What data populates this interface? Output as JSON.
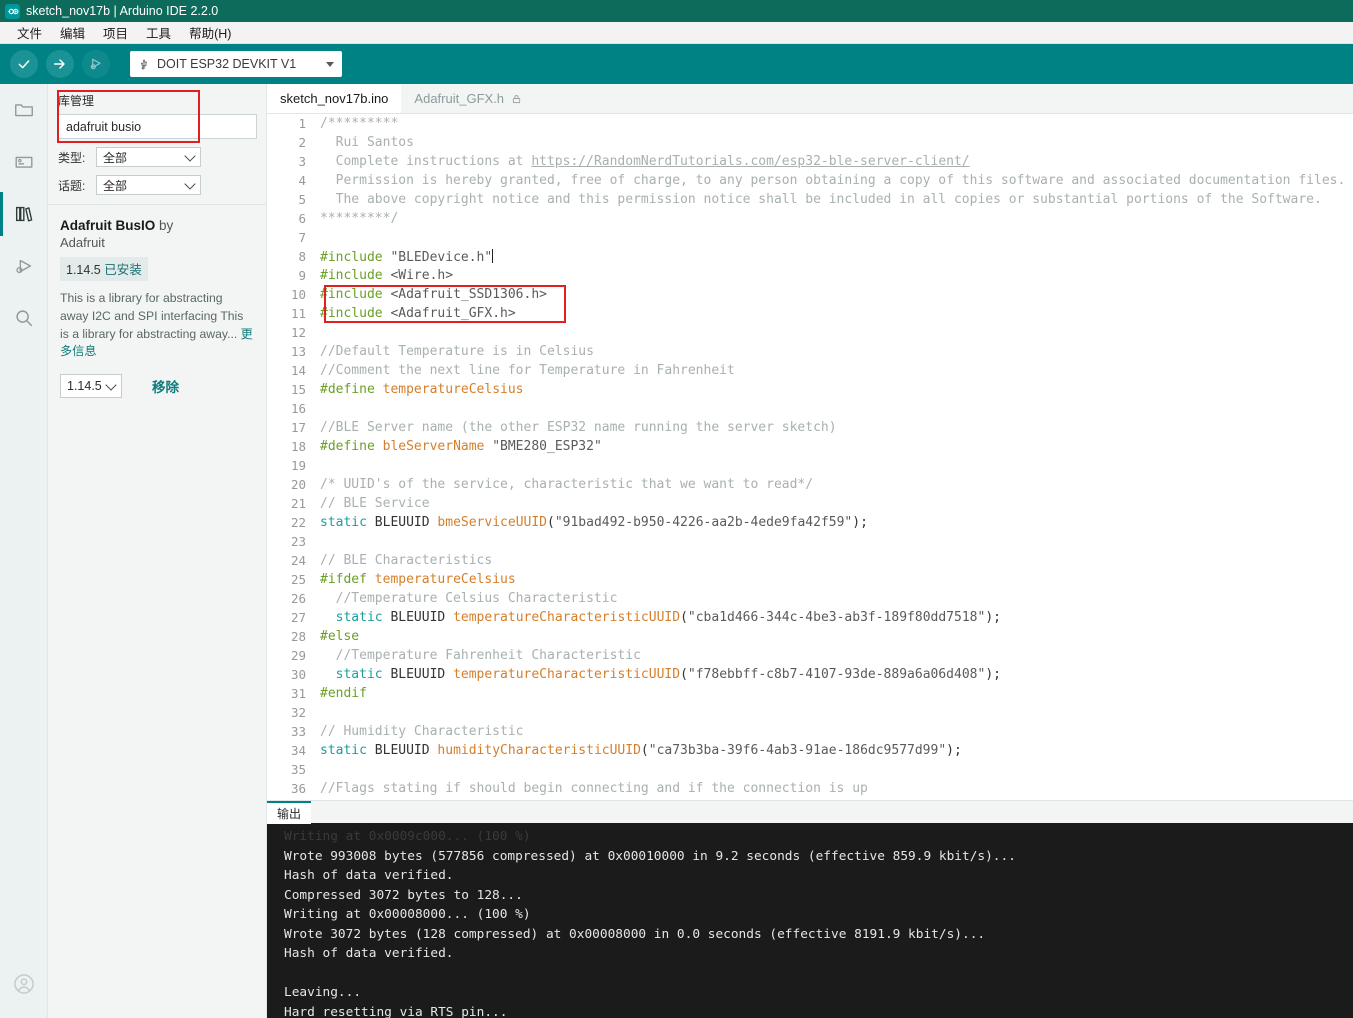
{
  "window": {
    "title": "sketch_nov17b | Arduino IDE 2.2.0",
    "logo_icon": "arduino-infinity-icon"
  },
  "menubar": {
    "items": [
      {
        "label": "文件",
        "name": "menu-file"
      },
      {
        "label": "编辑",
        "name": "menu-edit"
      },
      {
        "label": "项目",
        "name": "menu-sketch"
      },
      {
        "label": "工具",
        "name": "menu-tools"
      },
      {
        "label": "帮助(H)",
        "name": "menu-help"
      }
    ]
  },
  "toolbar": {
    "verify_icon": "checkmark-icon",
    "upload_icon": "arrow-right-icon",
    "debug_icon": "debug-icon",
    "board": {
      "usb_icon": "usb-icon",
      "name": "DOIT ESP32 DEVKIT V1",
      "caret_icon": "chevron-down-icon"
    }
  },
  "rail": {
    "items": [
      {
        "name": "sidebar-item-sketchbook",
        "icon": "folder-icon",
        "active": false
      },
      {
        "name": "sidebar-item-boards-manager",
        "icon": "board-icon",
        "active": false
      },
      {
        "name": "sidebar-item-library-manager",
        "icon": "books-icon",
        "active": true
      },
      {
        "name": "sidebar-item-debug",
        "icon": "debug-play-icon",
        "active": false
      },
      {
        "name": "sidebar-item-search",
        "icon": "search-icon",
        "active": false
      }
    ],
    "account_icon": "account-circle-icon"
  },
  "library_manager": {
    "title": "库管理",
    "search_value": "adafruit busio",
    "search_placeholder": "",
    "filters": [
      {
        "label": "类型:",
        "value": "全部",
        "name": "filter-type"
      },
      {
        "label": "话题:",
        "value": "全部",
        "name": "filter-topic"
      }
    ],
    "card": {
      "name": "Adafruit BusIO",
      "by": "by",
      "author": "Adafruit",
      "badge_version": "1.14.5",
      "badge_status": "已安装",
      "description": "This is a library for abstracting away I2C and SPI interfacing This is a library for abstracting away...",
      "more_info": "更多信息",
      "version_selected": "1.14.5",
      "remove_label": "移除"
    }
  },
  "tabs": [
    {
      "label": "sketch_nov17b.ino",
      "active": true,
      "locked": false,
      "name": "tab-sketch-ino"
    },
    {
      "label": "Adafruit_GFX.h",
      "active": false,
      "locked": true,
      "lock_icon": "lock-icon",
      "name": "tab-adafruit-gfx-h"
    }
  ],
  "editor": {
    "lines": [
      {
        "n": 1,
        "segments": [
          {
            "t": "/*********",
            "c": "cm"
          }
        ]
      },
      {
        "n": 2,
        "segments": [
          {
            "t": "  Rui Santos",
            "c": "cm"
          }
        ]
      },
      {
        "n": 3,
        "segments": [
          {
            "t": "  Complete instructions at ",
            "c": "cm"
          },
          {
            "t": "https://RandomNerdTutorials.com/esp32-ble-server-client/",
            "c": "lnk"
          }
        ]
      },
      {
        "n": 4,
        "segments": [
          {
            "t": "  Permission is hereby granted, free of charge, to any person obtaining a copy of this software and associated documentation files.",
            "c": "cm"
          }
        ]
      },
      {
        "n": 5,
        "segments": [
          {
            "t": "  The above copyright notice and this permission notice shall be included in all copies or substantial portions of the Software.",
            "c": "cm"
          }
        ]
      },
      {
        "n": 6,
        "segments": [
          {
            "t": "*********/",
            "c": "cm"
          }
        ]
      },
      {
        "n": 7,
        "segments": []
      },
      {
        "n": 8,
        "segments": [
          {
            "t": "#include",
            "c": "pp"
          },
          {
            "t": " ",
            "c": ""
          },
          {
            "t": "\"BLEDevice.h\"",
            "c": "str"
          }
        ],
        "caret": true
      },
      {
        "n": 9,
        "segments": [
          {
            "t": "#include",
            "c": "pp"
          },
          {
            "t": " ",
            "c": ""
          },
          {
            "t": "<Wire.h>",
            "c": "str"
          }
        ]
      },
      {
        "n": 10,
        "segments": [
          {
            "t": "#include",
            "c": "pp"
          },
          {
            "t": " ",
            "c": ""
          },
          {
            "t": "<Adafruit_SSD1306.h>",
            "c": "str"
          }
        ]
      },
      {
        "n": 11,
        "segments": [
          {
            "t": "#include",
            "c": "pp"
          },
          {
            "t": " ",
            "c": ""
          },
          {
            "t": "<Adafruit_GFX.h>",
            "c": "str"
          }
        ]
      },
      {
        "n": 12,
        "segments": []
      },
      {
        "n": 13,
        "segments": [
          {
            "t": "//Default Temperature is in Celsius",
            "c": "cm"
          }
        ]
      },
      {
        "n": 14,
        "segments": [
          {
            "t": "//Comment the next line for Temperature in Fahrenheit",
            "c": "cm"
          }
        ]
      },
      {
        "n": 15,
        "segments": [
          {
            "t": "#define",
            "c": "pp"
          },
          {
            "t": " ",
            "c": ""
          },
          {
            "t": "temperatureCelsius",
            "c": "fn"
          }
        ]
      },
      {
        "n": 16,
        "segments": []
      },
      {
        "n": 17,
        "segments": [
          {
            "t": "//BLE Server name (the other ESP32 name running the server sketch)",
            "c": "cm"
          }
        ]
      },
      {
        "n": 18,
        "segments": [
          {
            "t": "#define",
            "c": "pp"
          },
          {
            "t": " ",
            "c": ""
          },
          {
            "t": "bleServerName",
            "c": "fn"
          },
          {
            "t": " ",
            "c": ""
          },
          {
            "t": "\"BME280_ESP32\"",
            "c": "str"
          }
        ]
      },
      {
        "n": 19,
        "segments": []
      },
      {
        "n": 20,
        "segments": [
          {
            "t": "/* UUID's of the service, characteristic that we want to read*/",
            "c": "cm"
          }
        ]
      },
      {
        "n": 21,
        "segments": [
          {
            "t": "// BLE Service",
            "c": "cm"
          }
        ]
      },
      {
        "n": 22,
        "segments": [
          {
            "t": "static",
            "c": "kw"
          },
          {
            "t": " BLEUUID ",
            "c": ""
          },
          {
            "t": "bmeServiceUUID",
            "c": "fn"
          },
          {
            "t": "(",
            "c": ""
          },
          {
            "t": "\"91bad492-b950-4226-aa2b-4ede9fa42f59\"",
            "c": "str"
          },
          {
            "t": ");",
            "c": ""
          }
        ]
      },
      {
        "n": 23,
        "segments": []
      },
      {
        "n": 24,
        "segments": [
          {
            "t": "// BLE Characteristics",
            "c": "cm"
          }
        ]
      },
      {
        "n": 25,
        "segments": [
          {
            "t": "#ifdef",
            "c": "pp"
          },
          {
            "t": " ",
            "c": ""
          },
          {
            "t": "temperatureCelsius",
            "c": "fn"
          }
        ]
      },
      {
        "n": 26,
        "segments": [
          {
            "t": "  //Temperature Celsius Characteristic",
            "c": "cm"
          }
        ]
      },
      {
        "n": 27,
        "segments": [
          {
            "t": "  ",
            "c": ""
          },
          {
            "t": "static",
            "c": "kw"
          },
          {
            "t": " BLEUUID ",
            "c": ""
          },
          {
            "t": "temperatureCharacteristicUUID",
            "c": "fn"
          },
          {
            "t": "(",
            "c": ""
          },
          {
            "t": "\"cba1d466-344c-4be3-ab3f-189f80dd7518\"",
            "c": "str"
          },
          {
            "t": ");",
            "c": ""
          }
        ]
      },
      {
        "n": 28,
        "segments": [
          {
            "t": "#else",
            "c": "pp"
          }
        ]
      },
      {
        "n": 29,
        "segments": [
          {
            "t": "  //Temperature Fahrenheit Characteristic",
            "c": "cm"
          }
        ]
      },
      {
        "n": 30,
        "segments": [
          {
            "t": "  ",
            "c": ""
          },
          {
            "t": "static",
            "c": "kw"
          },
          {
            "t": " BLEUUID ",
            "c": ""
          },
          {
            "t": "temperatureCharacteristicUUID",
            "c": "fn"
          },
          {
            "t": "(",
            "c": ""
          },
          {
            "t": "\"f78ebbff-c8b7-4107-93de-889a6a06d408\"",
            "c": "str"
          },
          {
            "t": ");",
            "c": ""
          }
        ]
      },
      {
        "n": 31,
        "segments": [
          {
            "t": "#endif",
            "c": "pp"
          }
        ]
      },
      {
        "n": 32,
        "segments": []
      },
      {
        "n": 33,
        "segments": [
          {
            "t": "// Humidity Characteristic",
            "c": "cm"
          }
        ]
      },
      {
        "n": 34,
        "segments": [
          {
            "t": "static",
            "c": "kw"
          },
          {
            "t": " BLEUUID ",
            "c": ""
          },
          {
            "t": "humidityCharacteristicUUID",
            "c": "fn"
          },
          {
            "t": "(",
            "c": ""
          },
          {
            "t": "\"ca73b3ba-39f6-4ab3-91ae-186dc9577d99\"",
            "c": "str"
          },
          {
            "t": ");",
            "c": ""
          }
        ]
      },
      {
        "n": 35,
        "segments": []
      },
      {
        "n": 36,
        "segments": [
          {
            "t": "//Flags stating if should begin connecting and if the connection is up",
            "c": "cm"
          }
        ]
      }
    ]
  },
  "output": {
    "tab_label": "输出",
    "lines": [
      {
        "text": "Writing at 0x0009c000... (100 %)",
        "clipped": true
      },
      {
        "text": "Wrote 993008 bytes (577856 compressed) at 0x00010000 in 9.2 seconds (effective 859.9 kbit/s)...",
        "clipped": false
      },
      {
        "text": "Hash of data verified.",
        "clipped": false
      },
      {
        "text": "Compressed 3072 bytes to 128...",
        "clipped": false
      },
      {
        "text": "Writing at 0x00008000... (100 %)",
        "clipped": false
      },
      {
        "text": "Wrote 3072 bytes (128 compressed) at 0x00008000 in 0.0 seconds (effective 8191.9 kbit/s)...",
        "clipped": false
      },
      {
        "text": "Hash of data verified.",
        "clipped": false
      },
      {
        "text": "",
        "clipped": false
      },
      {
        "text": "Leaving...",
        "clipped": false
      },
      {
        "text": "Hard resetting via RTS pin...",
        "clipped": false
      }
    ]
  },
  "annotations": {
    "search_box_color": "#e02020",
    "include_box_color": "#e02020"
  }
}
